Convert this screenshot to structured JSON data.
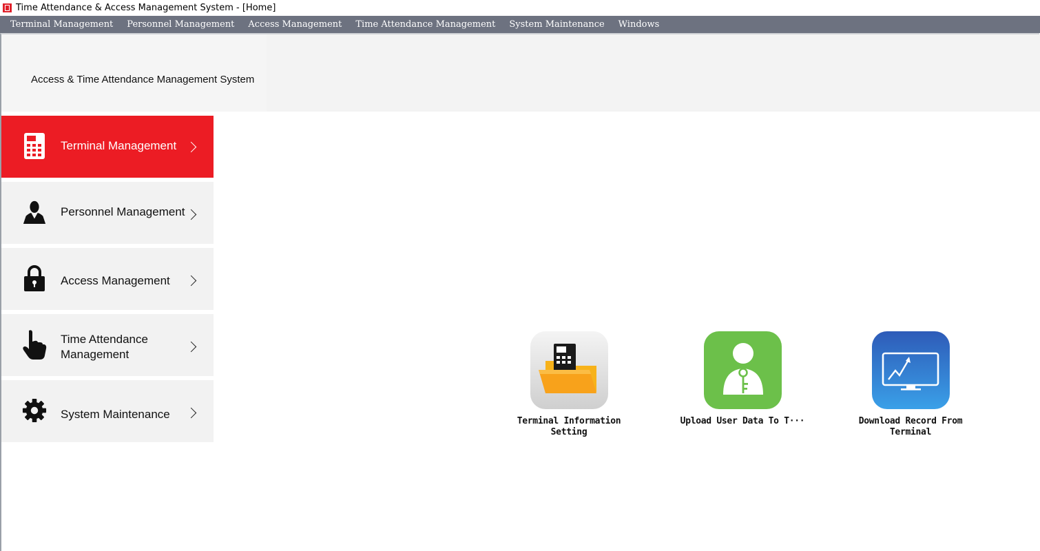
{
  "window": {
    "title": "Time Attendance & Access Management System - [Home]"
  },
  "menubar": {
    "items": [
      {
        "label": "Terminal Management"
      },
      {
        "label": "Personnel Management"
      },
      {
        "label": "Access Management"
      },
      {
        "label": "Time Attendance Management"
      },
      {
        "label": "System Maintenance"
      },
      {
        "label": "Windows"
      }
    ]
  },
  "banner": {
    "title": "Access & Time Attendance Management System"
  },
  "sidebar": {
    "items": [
      {
        "label": "Terminal Management",
        "icon": "terminal-icon",
        "active": true
      },
      {
        "label": "Personnel Management",
        "icon": "person-icon",
        "active": false
      },
      {
        "label": "Access Management",
        "icon": "lock-icon",
        "active": false
      },
      {
        "label": "Time Attendance\nManagement",
        "icon": "hand-pointer-icon",
        "active": false
      },
      {
        "label": "System Maintenance",
        "icon": "gear-icon",
        "active": false
      }
    ]
  },
  "tiles": [
    {
      "label": "Terminal Information Setting",
      "icon": "terminal-folder-icon"
    },
    {
      "label": "Upload User Data To T···",
      "icon": "user-key-icon"
    },
    {
      "label": "Download Record From Terminal",
      "icon": "monitor-chart-icon"
    }
  ],
  "colors": {
    "menubar_bg": "#6d7280",
    "active_item": "#ec1c24",
    "sidebar_bg": "#f2f2f2",
    "tile_green": "#6cc04a",
    "tile_blue": "#2f6fd0"
  }
}
